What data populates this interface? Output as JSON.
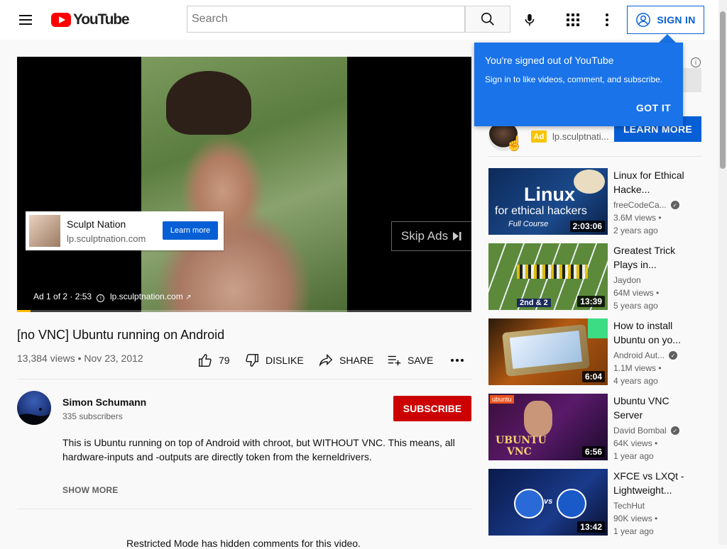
{
  "header": {
    "logo_text": "YouTube",
    "search_placeholder": "Search",
    "sign_in_label": "SIGN IN"
  },
  "player": {
    "ad_card": {
      "name": "Sculpt Nation",
      "url": "lp.sculptnation.com",
      "button_label": "Learn more"
    },
    "skip_label": "Skip Ads",
    "ad_info": "Ad 1 of 2 · 2:53",
    "ad_url": "lp.sculptnation.com",
    "ad_progress": 0.03
  },
  "video": {
    "title": "[no VNC] Ubuntu running on Android",
    "views": "13,384 views",
    "date": "Nov 23, 2012",
    "actions": {
      "like_count": "79",
      "dislike_label": "DISLIKE",
      "share_label": "SHARE",
      "save_label": "SAVE"
    }
  },
  "channel": {
    "name": "Simon Schumann",
    "subscribers": "335 subscribers",
    "subscribe_label": "SUBSCRIBE"
  },
  "description": {
    "text": "This is Ubuntu running on top of Android with chroot, but WITHOUT VNC. This means, all hardware-inputs and -outputs are directly token from the kerneldrivers.",
    "show_more": "SHOW MORE"
  },
  "comments_notice": "Restricted Mode has hidden comments for this video.",
  "tooltip": {
    "title": "You're signed out of YouTube",
    "body": "Sign in to like videos, comment, and subscribe.",
    "button": "GOT IT"
  },
  "sidebar_ad": {
    "badge": "Ad",
    "url": "lp.sculptnati...",
    "button": "LEARN MORE"
  },
  "recommendations": [
    {
      "title": "Linux for Ethical Hacke...",
      "channel": "freeCodeCa...",
      "verified": true,
      "views": "3.6M views",
      "age": "2 years ago",
      "duration": "2:03:06",
      "thumb_lines": [
        "Linux",
        "for ethical hackers",
        "Full Course"
      ]
    },
    {
      "title": "Greatest Trick Plays in...",
      "channel": "Jaydon",
      "verified": false,
      "views": "64M views",
      "age": "5 years ago",
      "duration": "13:39",
      "thumb_lines": [
        "2nd & 2"
      ]
    },
    {
      "title": "How to install Ubuntu on yo...",
      "channel": "Android Aut...",
      "verified": true,
      "views": "1.1M views",
      "age": "4 years ago",
      "duration": "6:04",
      "thumb_lines": []
    },
    {
      "title": "Ubuntu VNC Server",
      "channel": "David Bombal",
      "verified": true,
      "views": "64K views",
      "age": "1 year ago",
      "duration": "6:56",
      "thumb_lines": [
        "ubuntu",
        "UBUNTU",
        "VNC"
      ]
    },
    {
      "title": "XFCE vs LXQt - Lightweight...",
      "channel": "TechHut",
      "verified": false,
      "views": "90K views",
      "age": "1 year ago",
      "duration": "13:42",
      "thumb_lines": [
        "vs"
      ]
    }
  ],
  "colors": {
    "brand_red": "#ff0000",
    "link_blue": "#065fd4",
    "tooltip_blue": "#1a73e8",
    "subscribe_red": "#cc0000",
    "ad_yellow": "#f9c500"
  },
  "icons": [
    "menu-icon",
    "youtube-logo-icon",
    "search-icon",
    "mic-icon",
    "apps-grid-icon",
    "more-vert-icon",
    "account-icon",
    "info-icon",
    "skip-icon",
    "like-icon",
    "dislike-icon",
    "share-icon",
    "save-icon",
    "more-horiz-icon",
    "verified-icon",
    "external-link-icon"
  ]
}
